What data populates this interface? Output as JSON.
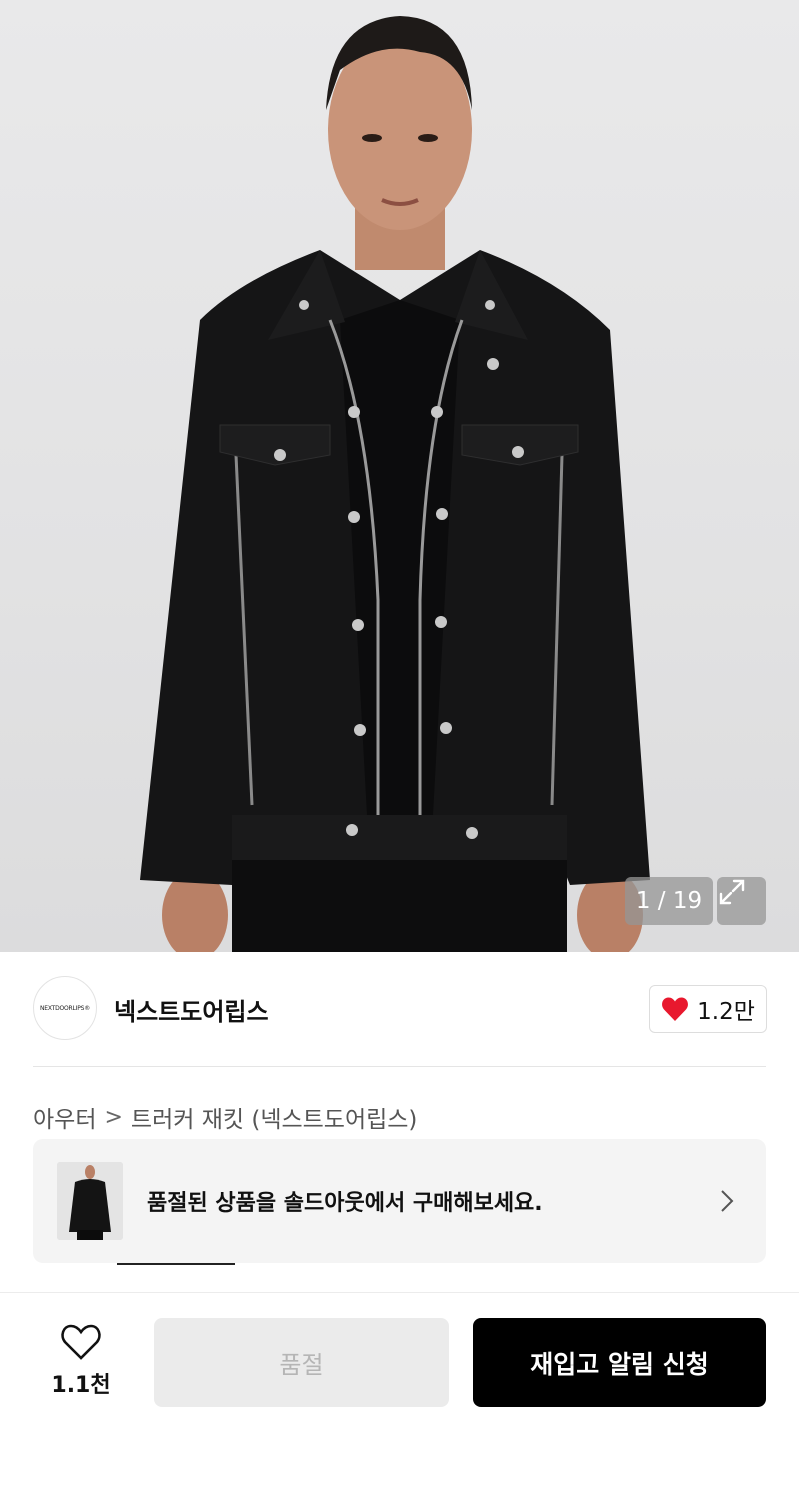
{
  "gallery": {
    "counter": "1 / 19",
    "expand_icon": "expand-arrows-icon"
  },
  "brand": {
    "logo_text": "NEXTDOORLIPS®",
    "name": "넥스트도어립스",
    "likes": "1.2만",
    "like_icon": "heart-filled-icon",
    "like_color": "#e8182e"
  },
  "breadcrumb": {
    "category": "아우터",
    "separator": ">",
    "product": "트러커 재킷 (넥스트도어립스)"
  },
  "soldout_banner": {
    "text": "품절된 상품을 솔드아웃에서 구매해보세요.",
    "chevron_icon": "chevron-right-icon"
  },
  "bottom_bar": {
    "wish_icon": "heart-outline-icon",
    "wish_count": "1.1천",
    "soldout_label": "품절",
    "restock_label": "재입고 알림 신청"
  }
}
